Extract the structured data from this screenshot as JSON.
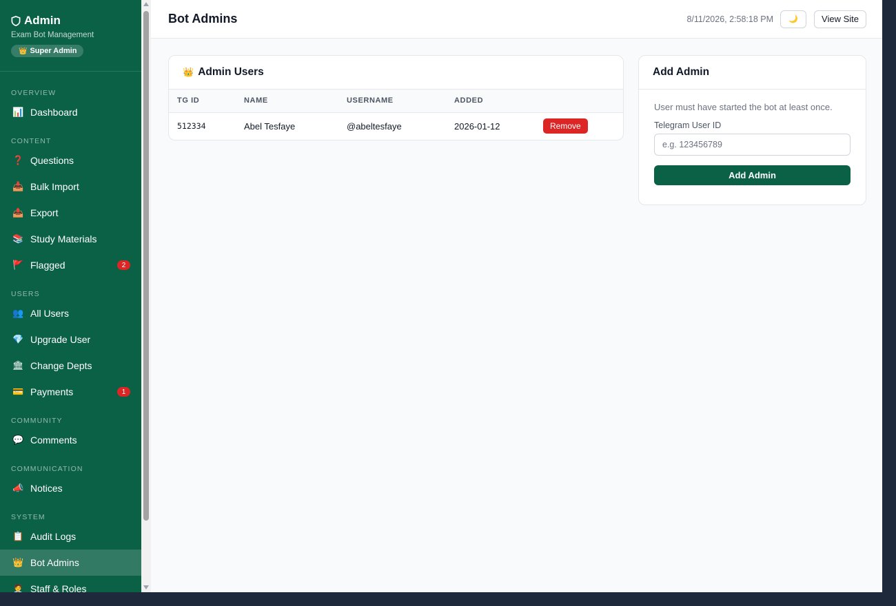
{
  "brand": {
    "title": "Admin",
    "subtitle": "Exam Bot Management",
    "role_badge": "Super Admin"
  },
  "sidebar": {
    "sections": [
      {
        "label": "OVERVIEW",
        "items": [
          {
            "label": "Dashboard",
            "icon": "chart-icon",
            "glyph": "📊"
          }
        ]
      },
      {
        "label": "CONTENT",
        "items": [
          {
            "label": "Questions",
            "icon": "question-icon",
            "glyph": "❓"
          },
          {
            "label": "Bulk Import",
            "icon": "import-icon",
            "glyph": "📥"
          },
          {
            "label": "Export",
            "icon": "export-icon",
            "glyph": "📤"
          },
          {
            "label": "Study Materials",
            "icon": "books-icon",
            "glyph": "📚"
          },
          {
            "label": "Flagged",
            "icon": "flag-icon",
            "glyph": "🚩",
            "badge": "2"
          }
        ]
      },
      {
        "label": "USERS",
        "items": [
          {
            "label": "All Users",
            "icon": "users-icon",
            "glyph": "👥"
          },
          {
            "label": "Upgrade User",
            "icon": "gem-icon",
            "glyph": "💎"
          },
          {
            "label": "Change Depts",
            "icon": "building-icon",
            "glyph": "🏛"
          },
          {
            "label": "Payments",
            "icon": "card-icon",
            "glyph": "💳",
            "badge": "1"
          }
        ]
      },
      {
        "label": "COMMUNITY",
        "items": [
          {
            "label": "Comments",
            "icon": "speech-icon",
            "glyph": "💬"
          }
        ]
      },
      {
        "label": "COMMUNICATION",
        "items": [
          {
            "label": "Notices",
            "icon": "megaphone-icon",
            "glyph": "📣"
          }
        ]
      },
      {
        "label": "SYSTEM",
        "items": [
          {
            "label": "Audit Logs",
            "icon": "clipboard-icon",
            "glyph": "📋"
          },
          {
            "label": "Bot Admins",
            "icon": "crown-icon",
            "glyph": "👑",
            "active": true
          },
          {
            "label": "Staff & Roles",
            "icon": "staff-icon",
            "glyph": "🧑‍💼"
          }
        ]
      }
    ]
  },
  "header": {
    "title": "Bot Admins",
    "timestamp": "8/11/2026, 2:58:18 PM",
    "theme_glyph": "🌙",
    "view_site": "View Site"
  },
  "admin_users": {
    "title": "Admin Users",
    "columns": [
      "TG ID",
      "NAME",
      "USERNAME",
      "ADDED"
    ],
    "rows": [
      {
        "tg_id": "512334",
        "name": "Abel Tesfaye",
        "username": "@abeltesfaye",
        "added": "2026-01-12",
        "action": "Remove"
      }
    ]
  },
  "add_admin": {
    "title": "Add Admin",
    "hint": "User must have started the bot at least once.",
    "field_label": "Telegram User ID",
    "placeholder": "e.g. 123456789",
    "submit": "Add Admin"
  },
  "colors": {
    "sidebar": "#0b6146",
    "primary": "#0b6146",
    "danger": "#dc2626",
    "background": "#f8fafc"
  }
}
